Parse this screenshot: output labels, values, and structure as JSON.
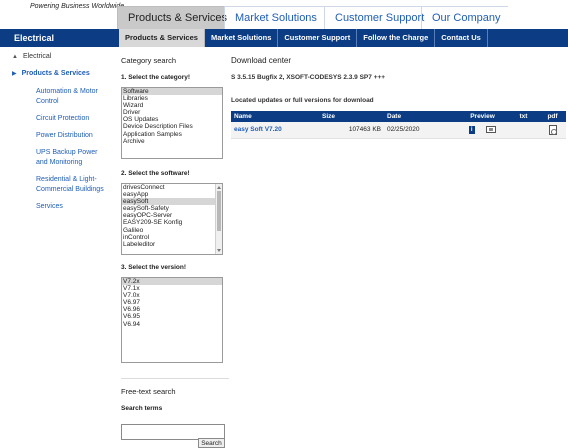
{
  "header": {
    "tagline": "Powering Business Worldwide",
    "top_tabs": [
      "Products & Services",
      "Market Solutions",
      "Customer Support",
      "Our Company"
    ]
  },
  "navbar": {
    "brand": "Electrical",
    "items": [
      "Products & Services",
      "Market Solutions",
      "Customer Support",
      "Follow the Charge",
      "Contact Us"
    ]
  },
  "sidebar": {
    "top": "Electrical",
    "active": "Products & Services",
    "items": [
      "Automation & Motor Control",
      "Circuit Protection",
      "Power Distribution",
      "UPS Backup Power and Monitoring",
      "Residential & Light-Commercial Buildings",
      "Services"
    ]
  },
  "category": {
    "title": "Category search",
    "step1": "1. Select the category!",
    "categories": [
      "Software",
      "Libraries",
      "Wizard",
      "Driver",
      "OS Updates",
      "Device Description Files",
      "Application Samples",
      "Archive"
    ],
    "step2": "2. Select the software!",
    "software": [
      "drivesConnect",
      "easyApp",
      "easySoft",
      "easySoft-Safety",
      "easyOPC-Server",
      "EASY209-SE Konfig",
      "Galileo",
      "inControl",
      "Labeleditor"
    ],
    "step3": "3. Select the version!",
    "versions": [
      "V7.2x",
      "V7.1x",
      "V7.0x",
      "V6.97",
      "V6.96",
      "V6.95",
      "V6.94"
    ]
  },
  "freetext": {
    "title": "Free-text search",
    "label": "Search terms",
    "input_value": "",
    "button": "Search"
  },
  "download": {
    "title": "Download center",
    "breadcrumb": "S 3.5.15 Bugfix 2, XSOFT-CODESYS 2.3.9 SP7 +++",
    "located": "Located updates or full versions for download",
    "columns": [
      "Name",
      "Size",
      "Date",
      "Preview",
      "txt",
      "pdf"
    ],
    "rows": [
      {
        "name": "easy Soft V7.20",
        "size": "107463 KB",
        "date": "02/25/2020",
        "info": "i"
      }
    ]
  }
}
